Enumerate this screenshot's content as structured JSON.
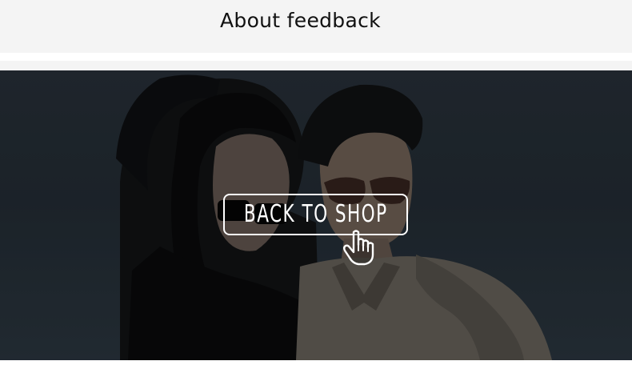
{
  "header": {
    "title": "About feedback"
  },
  "banner": {
    "cta_label": "BACK TO SHOP",
    "cta_icon": "pointing-hand-icon",
    "colors": {
      "background": "#263039",
      "cta_border": "#ffffff",
      "cta_text": "#ffffff"
    }
  }
}
